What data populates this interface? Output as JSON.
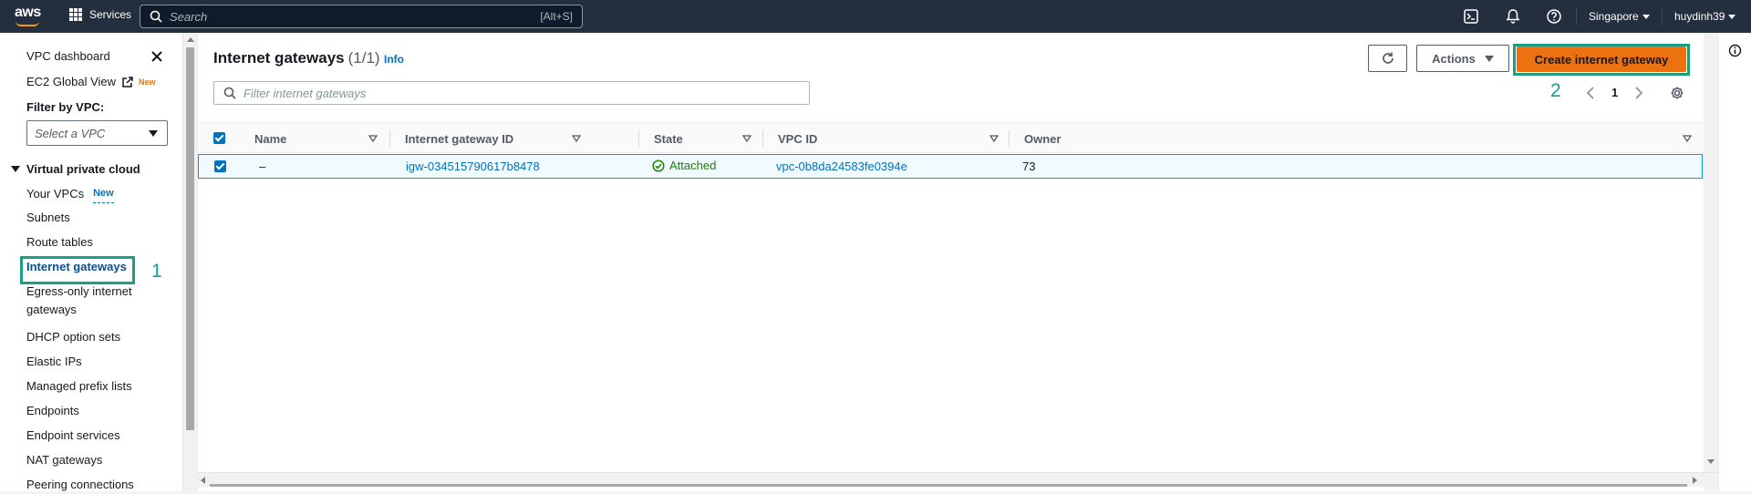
{
  "topnav": {
    "logo": "aws",
    "services_label": "Services",
    "search_placeholder": "Search",
    "search_shortcut": "[Alt+S]",
    "region": "Singapore",
    "user": "huydinh39"
  },
  "sidebar": {
    "dashboard": "VPC dashboard",
    "ec2_global": "EC2 Global View",
    "ec2_new": "New",
    "filter_label": "Filter by VPC:",
    "select_placeholder": "Select a VPC",
    "section": "Virtual private cloud",
    "your_vpcs": "Your VPCs",
    "your_vpcs_new": "New",
    "items": [
      "Subnets",
      "Route tables",
      "Internet gateways",
      "Egress-only internet",
      "gateways",
      "DHCP option sets",
      "Elastic IPs",
      "Managed prefix lists",
      "Endpoints",
      "Endpoint services",
      "NAT gateways",
      "Peering connections"
    ]
  },
  "annotations": {
    "step1": "1",
    "step2": "2",
    "highlight_color": "#1b9e85"
  },
  "main": {
    "title": "Internet gateways",
    "count": "(1/1)",
    "info": "Info",
    "actions_label": "Actions",
    "create_label": "Create internet gateway",
    "filter_placeholder": "Filter internet gateways",
    "page": "1",
    "columns": [
      "Name",
      "Internet gateway ID",
      "State",
      "VPC ID",
      "Owner"
    ],
    "rows": [
      {
        "name": "–",
        "igw_id": "igw-034515790617b8478",
        "state": "Attached",
        "vpc_id": "vpc-0b8da24583fe0394e",
        "owner": "73"
      }
    ]
  },
  "colors": {
    "nav_bg": "#232f3e",
    "primary": "#ec7211",
    "link": "#0073bb",
    "success": "#1d8102"
  }
}
